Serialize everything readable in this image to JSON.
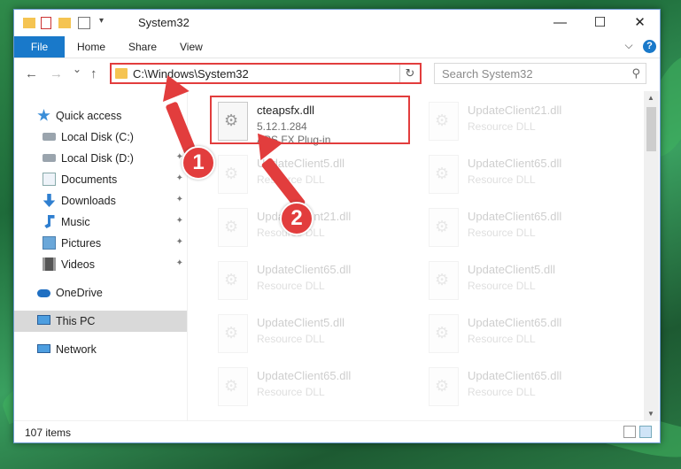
{
  "window": {
    "title": "System32",
    "controls": {
      "minimize": "—",
      "maximize": "☐",
      "close": "✕"
    }
  },
  "ribbon": {
    "tabs": [
      "File",
      "Home",
      "Share",
      "View"
    ],
    "expand_glyph": "⌵",
    "help_glyph": "?"
  },
  "nav": {
    "back": "←",
    "forward": "→",
    "recent": "⌄",
    "up": "↑",
    "address": "C:\\Windows\\System32",
    "refresh": "↻",
    "search_placeholder": "Search System32",
    "search_glyph": "⚲"
  },
  "sidebar": {
    "items": [
      {
        "label": "Quick access",
        "icon": "star-icon",
        "pinned": false
      },
      {
        "label": "Local Disk (C:)",
        "icon": "drive-icon",
        "pinned": true
      },
      {
        "label": "Local Disk (D:)",
        "icon": "drive-icon",
        "pinned": true
      },
      {
        "label": "Documents",
        "icon": "documents-icon",
        "pinned": true
      },
      {
        "label": "Downloads",
        "icon": "download-icon",
        "pinned": true
      },
      {
        "label": "Music",
        "icon": "music-icon",
        "pinned": true
      },
      {
        "label": "Pictures",
        "icon": "pictures-icon",
        "pinned": true
      },
      {
        "label": "Videos",
        "icon": "videos-icon",
        "pinned": true
      },
      {
        "label": "OneDrive",
        "icon": "cloud-icon",
        "pinned": false
      },
      {
        "label": "This PC",
        "icon": "computer-icon",
        "pinned": false,
        "selected": true
      },
      {
        "label": "Network",
        "icon": "network-icon",
        "pinned": false
      }
    ],
    "pin_glyph": "📌"
  },
  "files": [
    {
      "name": "cteapsfx.dll",
      "version": "5.12.1.284",
      "desc": "APS FX Plug-in",
      "highlighted": true
    },
    {
      "name": "UpdateClient21.dll",
      "version": "",
      "desc": "Resource DLL"
    },
    {
      "name": "UpdateClient5.dll",
      "version": "",
      "desc": "Resource DLL"
    },
    {
      "name": "UpdateClient65.dll",
      "version": "",
      "desc": "Resource DLL"
    },
    {
      "name": "UpdateClient21.dll",
      "version": "",
      "desc": "Resource DLL"
    },
    {
      "name": "UpdateClient65.dll",
      "version": "",
      "desc": "Resource DLL"
    },
    {
      "name": "UpdateClient65.dll",
      "version": "",
      "desc": "Resource DLL"
    },
    {
      "name": "UpdateClient5.dll",
      "version": "",
      "desc": "Resource DLL"
    },
    {
      "name": "UpdateClient5.dll",
      "version": "",
      "desc": "Resource DLL"
    },
    {
      "name": "UpdateClient65.dll",
      "version": "",
      "desc": "Resource DLL"
    },
    {
      "name": "UpdateClient65.dll",
      "version": "",
      "desc": "Resource DLL"
    },
    {
      "name": "UpdateClient65.dll",
      "version": "",
      "desc": "Resource DLL"
    }
  ],
  "status": {
    "items": "107 items"
  },
  "callouts": [
    "1",
    "2"
  ],
  "colors": {
    "accent": "#1979ca",
    "highlight": "#e23d3d"
  }
}
